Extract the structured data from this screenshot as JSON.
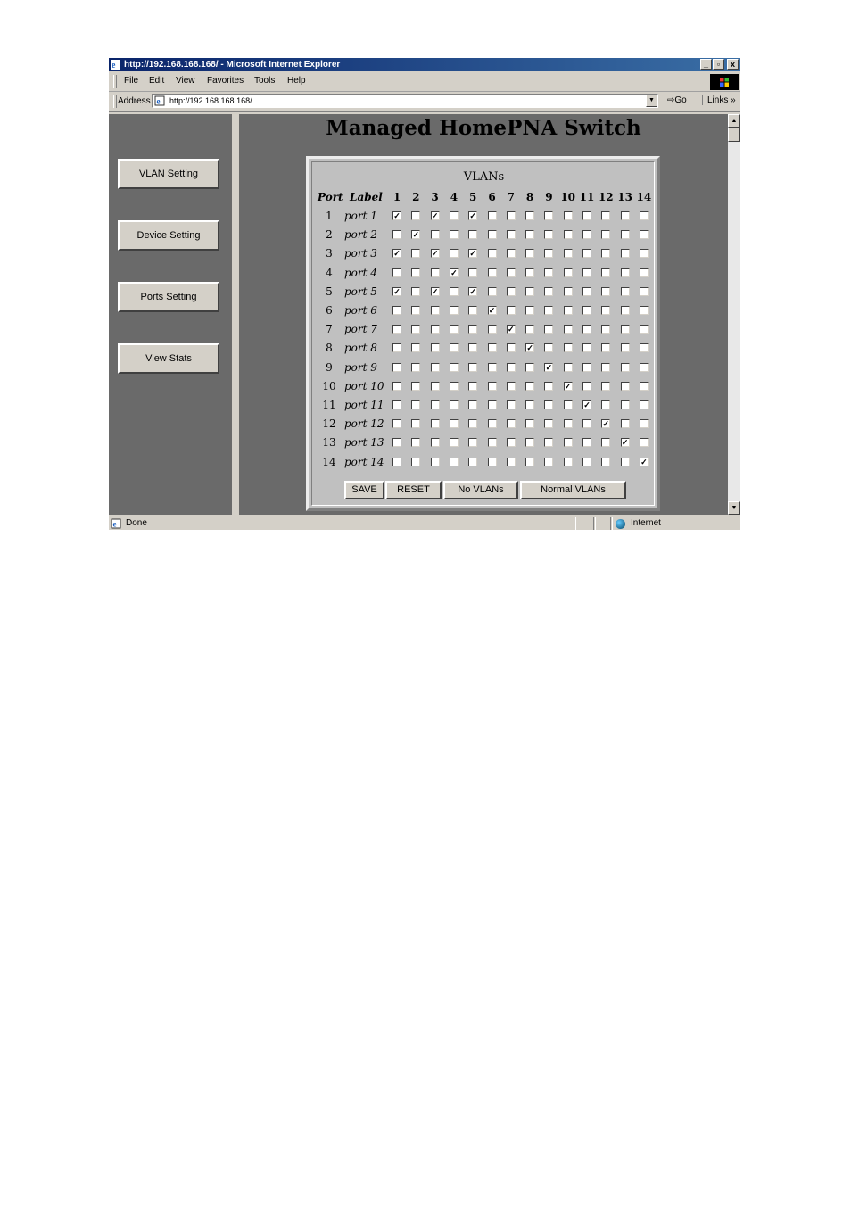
{
  "window": {
    "title": "http://192.168.168.168/ - Microsoft Internet Explorer",
    "controls": {
      "minimize": "_",
      "maximize": "▫",
      "close": "x"
    }
  },
  "menu": [
    "File",
    "Edit",
    "View",
    "Favorites",
    "Tools",
    "Help"
  ],
  "address": {
    "label": "Address",
    "url": "http://192.168.168.168/",
    "go_label": "Go",
    "links_label": "Links »"
  },
  "sidebar": {
    "buttons": [
      "VLAN Setting",
      "Device Setting",
      "Ports Setting",
      "View Stats"
    ]
  },
  "main": {
    "title": "Managed HomePNA Switch",
    "vlans_title": "VLANs",
    "col_port": "Port",
    "col_label": "Label",
    "vlan_headers": [
      "1",
      "2",
      "3",
      "4",
      "5",
      "6",
      "7",
      "8",
      "9",
      "10",
      "11",
      "12",
      "13",
      "14"
    ],
    "rows": [
      {
        "port": "1",
        "label": "port 1",
        "vlans": [
          1,
          3,
          5
        ]
      },
      {
        "port": "2",
        "label": "port 2",
        "vlans": [
          2
        ]
      },
      {
        "port": "3",
        "label": "port 3",
        "vlans": [
          1,
          3,
          5
        ]
      },
      {
        "port": "4",
        "label": "port 4",
        "vlans": [
          4
        ]
      },
      {
        "port": "5",
        "label": "port 5",
        "vlans": [
          1,
          3,
          5
        ]
      },
      {
        "port": "6",
        "label": "port 6",
        "vlans": [
          6
        ]
      },
      {
        "port": "7",
        "label": "port 7",
        "vlans": [
          7
        ]
      },
      {
        "port": "8",
        "label": "port 8",
        "vlans": [
          8
        ]
      },
      {
        "port": "9",
        "label": "port 9",
        "vlans": [
          9
        ]
      },
      {
        "port": "10",
        "label": "port 10",
        "vlans": [
          10
        ]
      },
      {
        "port": "11",
        "label": "port 11",
        "vlans": [
          11
        ]
      },
      {
        "port": "12",
        "label": "port 12",
        "vlans": [
          12
        ]
      },
      {
        "port": "13",
        "label": "port 13",
        "vlans": [
          13
        ]
      },
      {
        "port": "14",
        "label": "port 14",
        "vlans": [
          14
        ]
      }
    ],
    "buttons": {
      "save": "SAVE",
      "reset": "RESET",
      "no_vlans": "No VLANs",
      "normal_vlans": "Normal VLANs"
    },
    "check_glyph": "✓"
  },
  "status": {
    "text": "Done",
    "zone": "Internet"
  }
}
